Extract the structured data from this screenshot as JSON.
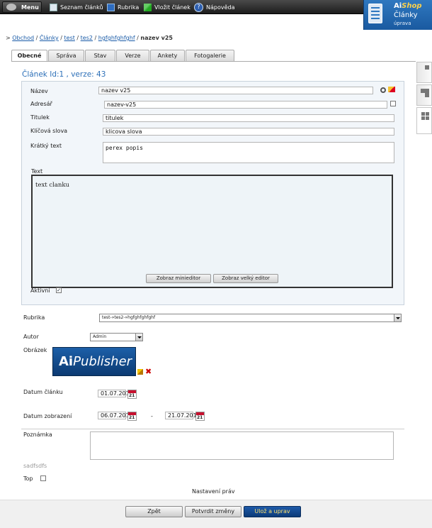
{
  "topbar": {
    "menu_label": "Menu",
    "nav": [
      {
        "label": "Seznam článků",
        "icon": "list-icon"
      },
      {
        "label": "Rubrika",
        "icon": "book-icon"
      },
      {
        "label": "Vložit článek",
        "icon": "pencil-icon"
      },
      {
        "label": "Nápověda",
        "icon": "help-icon"
      }
    ]
  },
  "brand": {
    "ai": "Ai",
    "shop": "Shop",
    "section": "Články",
    "mode": "úprava"
  },
  "breadcrumb": {
    "links": [
      "Obchod",
      "Články",
      "test",
      "tes2",
      "hgfghfghfghf"
    ],
    "current": "nazev v25"
  },
  "tabs": [
    "Obecné",
    "Správa",
    "Stav",
    "Verze",
    "Ankety",
    "Fotogalerie"
  ],
  "article_title": "Článek Id:1 , verze: 43",
  "form": {
    "name_label": "Název",
    "name_value": "nazev v25",
    "address_label": "Adresář",
    "address_value": "nazev-v25",
    "headline_label": "Titulek",
    "headline_value": "titulek",
    "keywords_label": "Klíčová slova",
    "keywords_value": "klicova slova",
    "short_label": "Krátký text",
    "short_value": "perex popis",
    "text_label": "Text",
    "text_value": "text clanku",
    "minieditor_btn": "Zobraz minieditor",
    "bigeditor_btn": "Zobraz velký editor",
    "active_label": "Aktivní",
    "active_check": "✓"
  },
  "details": {
    "rubric_label": "Rubrika",
    "rubric_value": "test-»tes2-»hgfghfghfghf",
    "author_label": "Autor",
    "author_value": "Admin",
    "image_label": "Obrázek",
    "image_text_ai": "Ai",
    "image_text_rest": "Publisher",
    "article_date_label": "Datum článku",
    "article_date": "01.07.2010",
    "display_date_label": "Datum zobrazení",
    "display_from": "06.07.2010",
    "display_dash": "-",
    "display_to": "21.07.2010",
    "note_label": "Poznámka",
    "note_value": "",
    "extra_text": "sadfsdfs",
    "top_label": "Top",
    "rights_label": "Nastavení práv"
  },
  "actions": {
    "back": "Zpět",
    "confirm": "Potvrdit změny",
    "save": "Ulož a uprav"
  }
}
